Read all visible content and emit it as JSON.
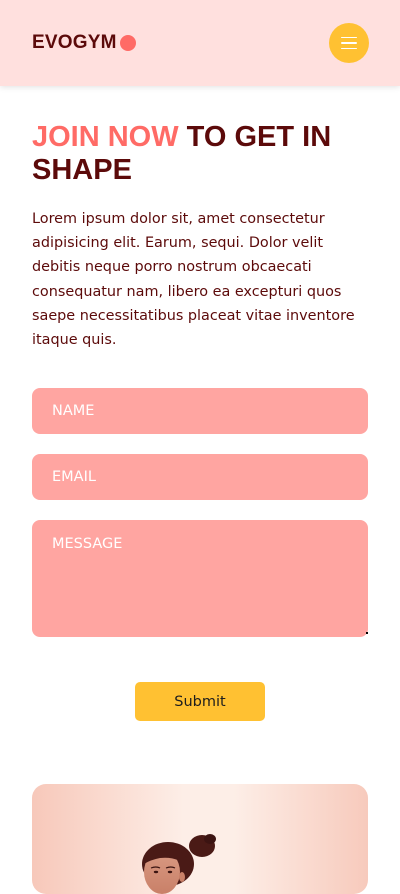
{
  "header": {
    "logo_text": "EVOGYM",
    "menu_icon": "hamburger-menu-icon"
  },
  "hero": {
    "title_accent": "JOIN NOW",
    "title_rest": " TO GET IN SHAPE",
    "description": "Lorem ipsum dolor sit, amet consectetur adipisicing elit. Earum, sequi. Dolor velit debitis neque porro nostrum obcaecati consequatur nam, libero ea excepturi quos saepe necessitatibus placeat vitae inventore itaque quis."
  },
  "form": {
    "name_placeholder": "NAME",
    "email_placeholder": "EMAIL",
    "message_placeholder": "MESSAGE",
    "submit_label": "Submit"
  },
  "colors": {
    "header_bg": "#ffe0de",
    "brand_dark": "#5c0a0a",
    "accent": "#ff6b66",
    "field_bg": "#ffa5a1",
    "button_yellow": "#ffc132"
  }
}
